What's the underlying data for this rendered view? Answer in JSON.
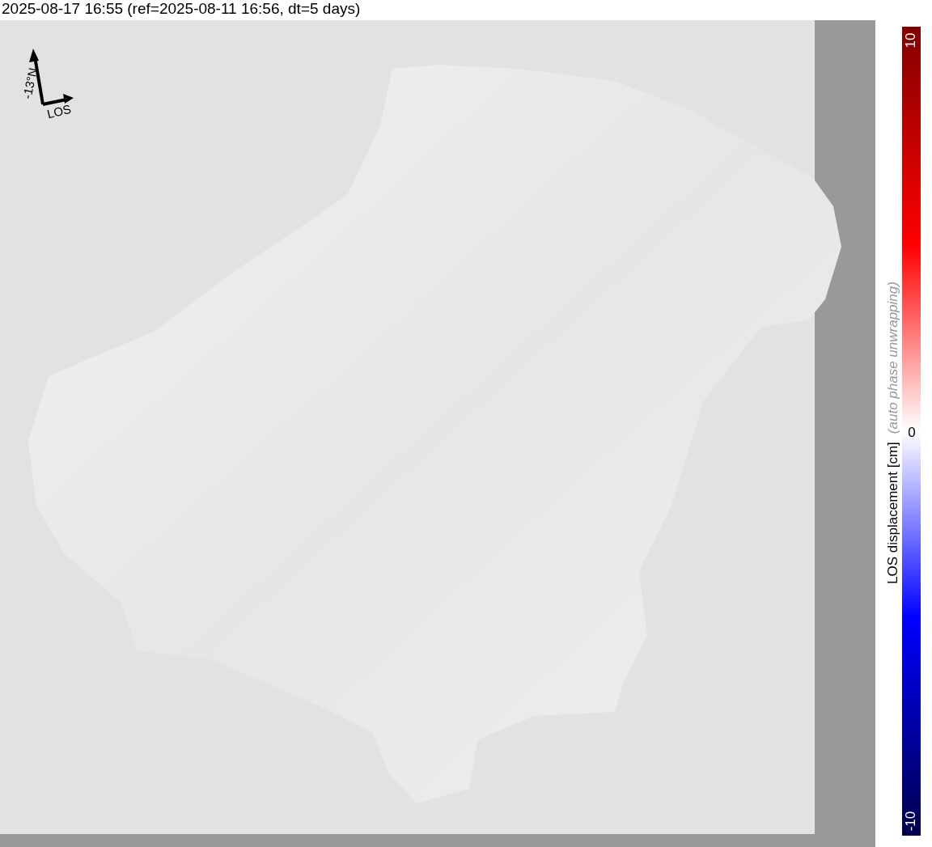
{
  "title": "2025-08-17 16:55 (ref=2025-08-11 16:56, dt=5 days)",
  "compass": {
    "north_label": "-13°N",
    "los_label": "LOS"
  },
  "colorbar": {
    "label": "LOS displacement [cm]",
    "note": "(auto phase unwrapping)",
    "ticks": [
      "10",
      "0",
      "-10"
    ]
  }
}
